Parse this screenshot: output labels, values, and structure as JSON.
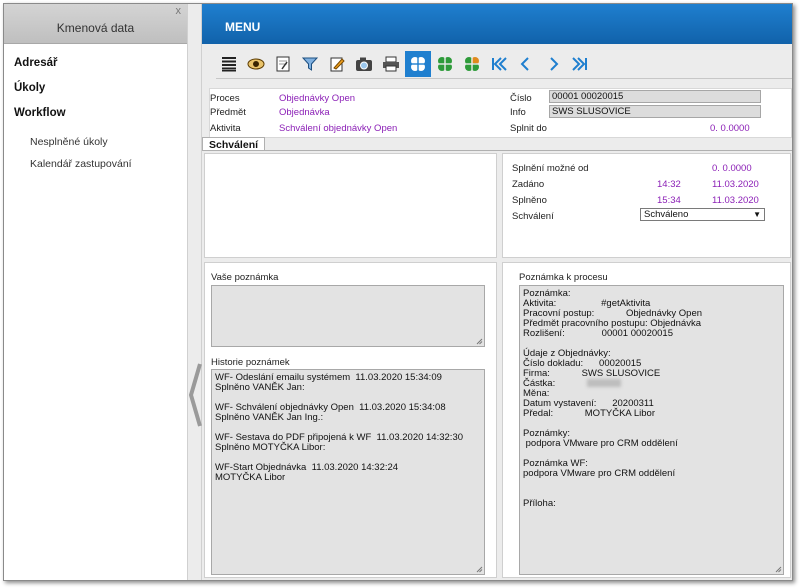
{
  "sidebar": {
    "title": "Kmenová data",
    "close_label": "x",
    "sections": [
      {
        "label": "Adresář"
      },
      {
        "label": "Úkoly"
      },
      {
        "label": "Workflow"
      }
    ],
    "subitems": [
      {
        "label": "Nesplněné úkoly"
      },
      {
        "label": "Kalendář zastupování"
      }
    ]
  },
  "menu": {
    "title": "MENU"
  },
  "toolbar": {
    "icons": [
      "list-icon",
      "eye-icon",
      "document-icon",
      "filter-icon",
      "edit-icon",
      "camera-icon",
      "print-icon",
      "clover-blue-icon",
      "clover-green-icon",
      "clover-orange-icon",
      "first-page-icon",
      "prev-page-icon",
      "next-page-icon",
      "last-page-icon"
    ],
    "active_icon": "clover-blue-icon"
  },
  "form": {
    "proces_label": "Proces",
    "proces_value": "Objednávky Open",
    "predmet_label": "Předmět",
    "predmet_value": "Objednávka",
    "aktivita_label": "Aktivita",
    "aktivita_value": "Schválení objednávky Open",
    "cislo_label": "Číslo",
    "cislo_value": "00001 00020015",
    "info_label": "Info",
    "info_value": "SWS SLUSOVICE",
    "splnit_label": "Splnit do",
    "splnit_value": "0. 0.0000"
  },
  "tab": {
    "label": "Schválení"
  },
  "schedule": {
    "mozne_label": "Splnění možné od",
    "mozne_date": "0. 0.0000",
    "zadano_label": "Zadáno",
    "zadano_time": "14:32",
    "zadano_date": "11.03.2020",
    "splneno_label": "Splněno",
    "splneno_time": "15:34",
    "splneno_date": "11.03.2020",
    "schvaleni_label": "Schválení",
    "schvaleni_value": "Schváleno"
  },
  "notes": {
    "vase_label": "Vaše poznámka",
    "vase_value": "",
    "historie_label": "Historie poznámek",
    "historie_lines": [
      "WF- Odeslání emailu systémem  11.03.2020 15:34:09",
      "Splněno VANĚK Jan:",
      "",
      "WF- Schválení objednávky Open  11.03.2020 15:34:08",
      "Splněno VANĚK Jan Ing.:",
      "",
      "WF- Sestava do PDF připojená k WF  11.03.2020 14:32:30",
      "Splněno MOTYČKA Libor:",
      "",
      "WF-Start Objednávka  11.03.2020 14:32:24",
      "MOTYČKA Libor"
    ],
    "proces_label": "Poznámka k procesu",
    "proces_lines": [
      "Poznámka:",
      "Aktivita:                 #getAktivita",
      "Pracovní postup:            Objednávky Open",
      "Předmět pracovního postupu: Objednávka",
      "Rozlišení:              00001 00020015",
      "",
      "Údaje z Objednávky:",
      "Číslo dokladu:      00020015",
      "Firma:            SWS SLUSOVICE",
      "Částka:",
      "Měna:",
      "Datum vystavení:      20200311",
      "Předal:            MOTYČKA Libor",
      "",
      "Poznámky:",
      " podpora VMware pro CRM oddělení",
      "",
      "Poznámka WF:",
      "podpora VMware pro CRM oddělení",
      "",
      "",
      "Příloha:"
    ]
  }
}
